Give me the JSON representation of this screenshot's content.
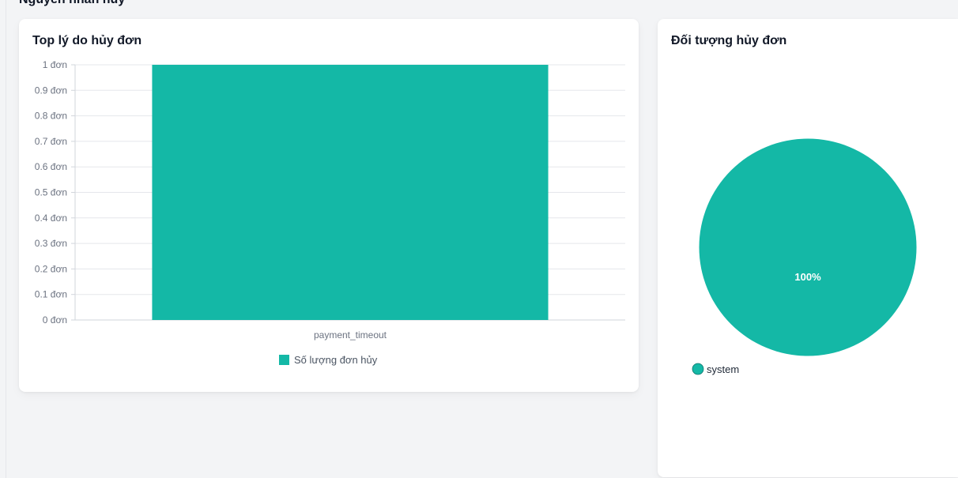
{
  "page": {
    "section_title": "Nguyên nhân hủy"
  },
  "cards": {
    "bar_title": "Top lý do hủy đơn",
    "pie_title": "Đối tượng hủy đơn"
  },
  "chart_data": [
    {
      "type": "bar",
      "title": "Top lý do hủy đơn",
      "categories": [
        "payment_timeout"
      ],
      "series": [
        {
          "name": "Số lượng đơn hủy",
          "values": [
            1
          ],
          "color": "#14b8a6"
        }
      ],
      "ylim": [
        0,
        1
      ],
      "yticks": [
        "0 đơn",
        "0.1 đơn",
        "0.2 đơn",
        "0.3 đơn",
        "0.4 đơn",
        "0.5 đơn",
        "0.6 đơn",
        "0.7 đơn",
        "0.8 đơn",
        "0.9 đơn",
        "1 đơn"
      ],
      "grid": true,
      "legend": "bottom"
    },
    {
      "type": "pie",
      "title": "Đối tượng hủy đơn",
      "slices": [
        {
          "label": "system",
          "value": 100,
          "display": "100%",
          "color": "#14b8a6"
        }
      ],
      "legend": "bottom-left"
    }
  ]
}
